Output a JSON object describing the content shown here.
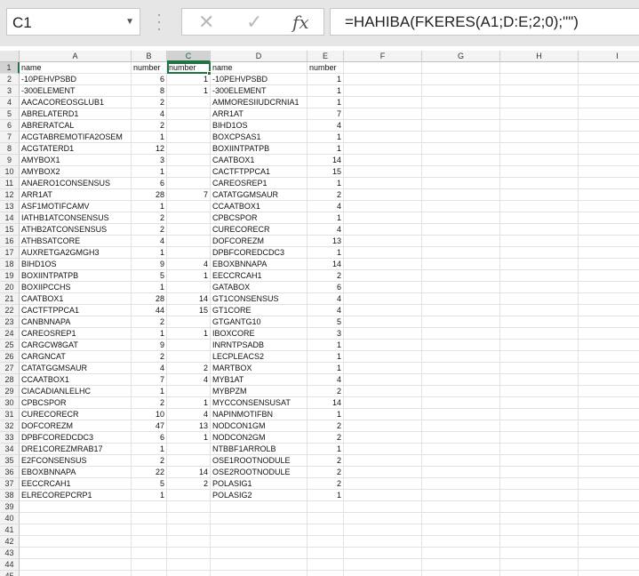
{
  "formula_bar": {
    "name_box": "C1",
    "cancel_glyph": "✕",
    "enter_glyph": "✓",
    "fx_label": "fx",
    "formula": "=HAHIBA(FKERES(A1;D:E;2;0);\"\")"
  },
  "columns": [
    "A",
    "B",
    "C",
    "D",
    "E",
    "F",
    "G",
    "H",
    "I"
  ],
  "selected_column": "C",
  "selected_row": 1,
  "rows": [
    [
      "name",
      "number",
      "number",
      "name",
      "number"
    ],
    [
      "-10PEHVPSBD",
      "6",
      "1",
      "-10PEHVPSBD",
      "1"
    ],
    [
      "-300ELEMENT",
      "8",
      "1",
      "-300ELEMENT",
      "1"
    ],
    [
      "AACACOREOSGLUB1",
      "2",
      "",
      "AMMORESIIUDCRNIA1",
      "1"
    ],
    [
      "ABRELATERD1",
      "4",
      "",
      "ARR1AT",
      "7"
    ],
    [
      "ABRERATCAL",
      "2",
      "",
      "BIHD1OS",
      "4"
    ],
    [
      "ACGTABREMOTIFA2OSEM",
      "1",
      "",
      "BOXCPSAS1",
      "1"
    ],
    [
      "ACGTATERD1",
      "12",
      "",
      "BOXIINTPATPB",
      "1"
    ],
    [
      "AMYBOX1",
      "3",
      "",
      "CAATBOX1",
      "14"
    ],
    [
      "AMYBOX2",
      "1",
      "",
      "CACTFTPPCA1",
      "15"
    ],
    [
      "ANAERO1CONSENSUS",
      "6",
      "",
      "CAREOSREP1",
      "1"
    ],
    [
      "ARR1AT",
      "28",
      "7",
      "CATATGGMSAUR",
      "2"
    ],
    [
      "ASF1MOTIFCAMV",
      "1",
      "",
      "CCAATBOX1",
      "4"
    ],
    [
      "IATHB1ATCONSENSUS",
      "2",
      "",
      "CPBCSPOR",
      "1"
    ],
    [
      "ATHB2ATCONSENSUS",
      "2",
      "",
      "CURECORECR",
      "4"
    ],
    [
      "ATHBSATCORE",
      "4",
      "",
      "DOFCOREZM",
      "13"
    ],
    [
      "AUXRETGA2GMGH3",
      "1",
      "",
      "DPBFCOREDCDC3",
      "1"
    ],
    [
      "BIHD1OS",
      "9",
      "4",
      "EBOXBNNAPA",
      "14"
    ],
    [
      "BOXIINTPATPB",
      "5",
      "1",
      "EECCRCAH1",
      "2"
    ],
    [
      "BOXIIPCCHS",
      "1",
      "",
      "GATABOX",
      "6"
    ],
    [
      "CAATBOX1",
      "28",
      "14",
      "GT1CONSENSUS",
      "4"
    ],
    [
      "CACTFTPPCA1",
      "44",
      "15",
      "GT1CORE",
      "4"
    ],
    [
      "CANBNNAPA",
      "2",
      "",
      "GTGANTG10",
      "5"
    ],
    [
      "CAREOSREP1",
      "1",
      "1",
      "IBOXCORE",
      "3"
    ],
    [
      "CARGCW8GAT",
      "9",
      "",
      "INRNTPSADB",
      "1"
    ],
    [
      "CARGNCAT",
      "2",
      "",
      "LECPLEACS2",
      "1"
    ],
    [
      "CATATGGMSAUR",
      "4",
      "2",
      "MARTBOX",
      "1"
    ],
    [
      "CCAATBOX1",
      "7",
      "4",
      "MYB1AT",
      "4"
    ],
    [
      "CIACADIANLELHC",
      "1",
      "",
      "MYBPZM",
      "2"
    ],
    [
      "CPBCSPOR",
      "2",
      "1",
      "MYCCONSENSUSAT",
      "14"
    ],
    [
      "CURECORECR",
      "10",
      "4",
      "NAPINMOTIFBN",
      "1"
    ],
    [
      "DOFCOREZM",
      "47",
      "13",
      "NODCON1GM",
      "2"
    ],
    [
      "DPBFCOREDCDC3",
      "6",
      "1",
      "NODCON2GM",
      "2"
    ],
    [
      "DRE1COREZMRAB17",
      "1",
      "",
      "NTBBF1ARROLB",
      "1"
    ],
    [
      "E2FCONSENSUS",
      "2",
      "",
      "OSE1ROOTNODULE",
      "2"
    ],
    [
      "EBOXBNNAPA",
      "22",
      "14",
      "OSE2ROOTNODULE",
      "2"
    ],
    [
      "EECCRCAH1",
      "5",
      "2",
      "POLASIG1",
      "2"
    ],
    [
      "ELRECOREPCRP1",
      "1",
      "",
      "POLASIG2",
      "1"
    ],
    [
      "",
      "",
      "",
      "",
      ""
    ],
    [
      "",
      "",
      "",
      "",
      ""
    ],
    [
      "",
      "",
      "",
      "",
      ""
    ],
    [
      "",
      "",
      "",
      "",
      ""
    ],
    [
      "",
      "",
      "",
      "",
      ""
    ],
    [
      "",
      "",
      "",
      "",
      ""
    ],
    [
      "",
      "",
      "",
      "",
      ""
    ]
  ]
}
